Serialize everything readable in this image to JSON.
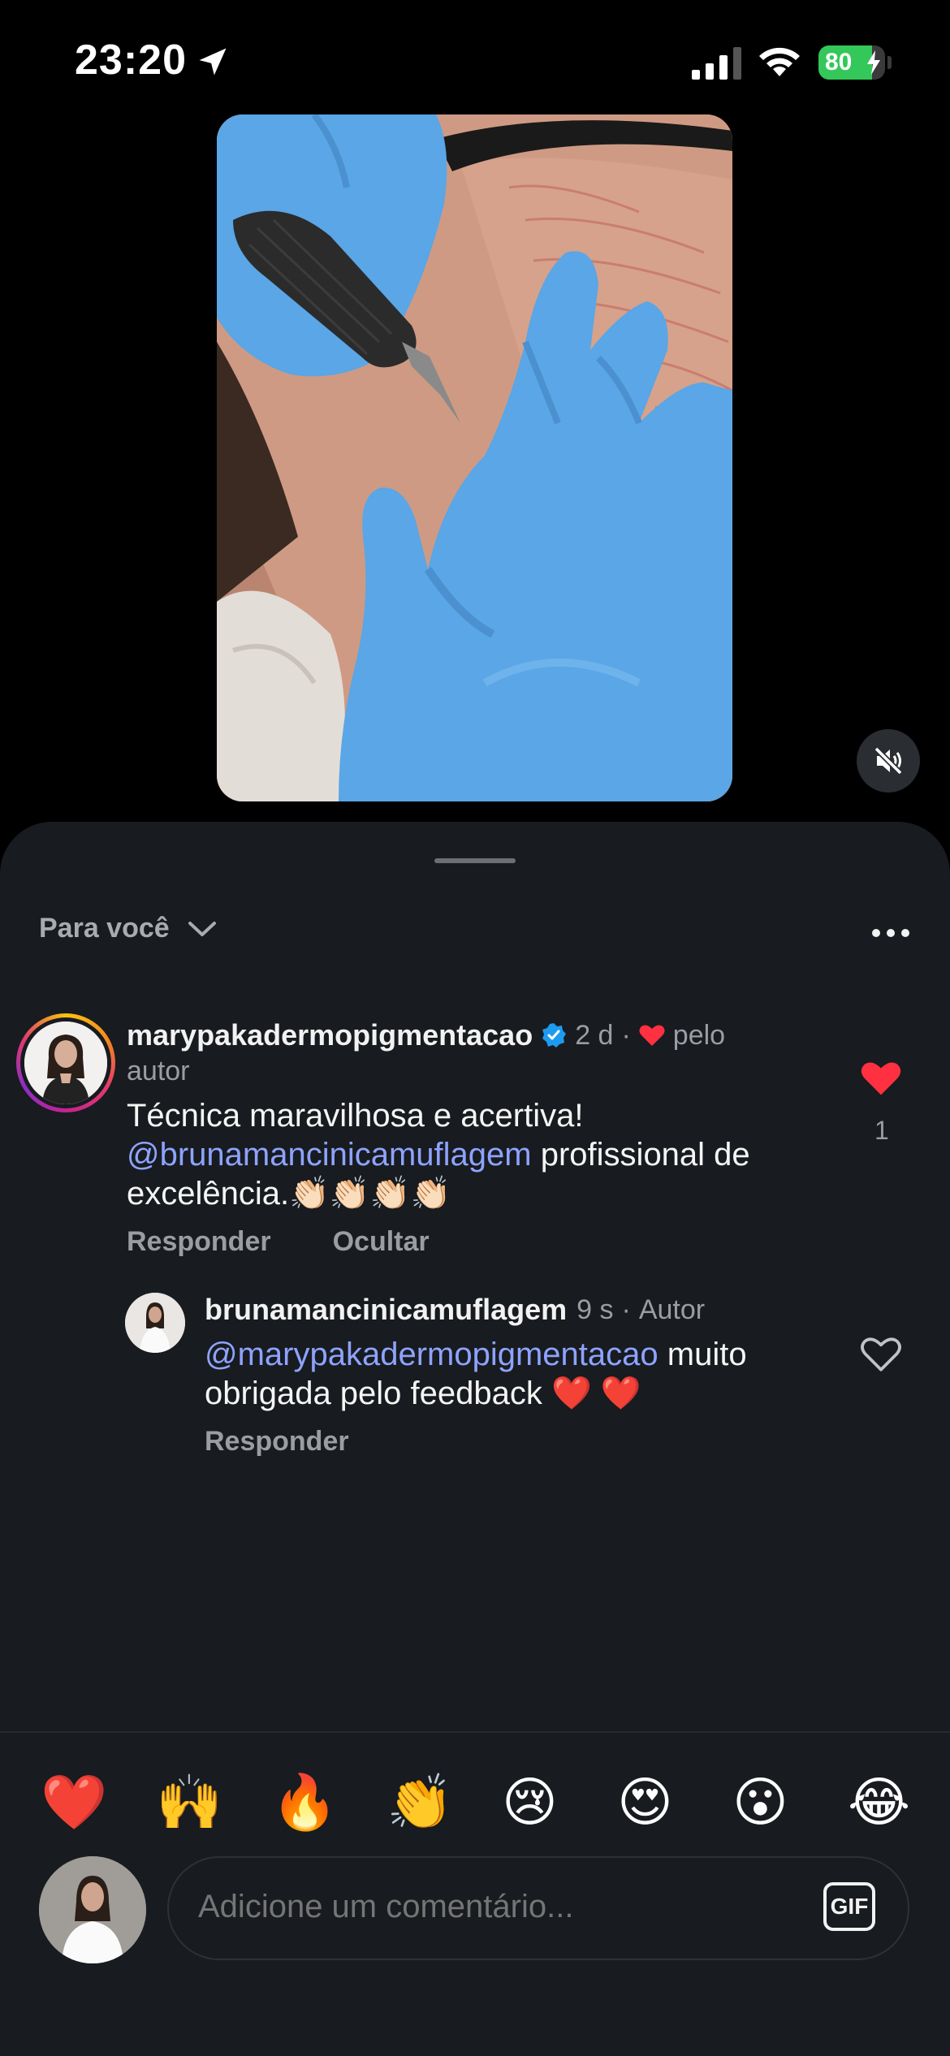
{
  "status_bar": {
    "time": "23:20",
    "battery": "80",
    "battery_level": 0.8
  },
  "video": {
    "muted": true
  },
  "sheet": {
    "filter_label": "Para você"
  },
  "comments": [
    {
      "username": "marypakadermopigmentacao",
      "verified": true,
      "age": "2 d",
      "separator": "·",
      "liked_by_author_label_1": "pelo",
      "liked_by_author_label_2": "autor",
      "text_line1": "Técnica maravilhosa e acertiva!",
      "mention": "@brunamancinicamuflagem",
      "text_line2_rest": " profissional de",
      "text_line3": "excelência.👏🏻👏🏻👏🏻👏🏻",
      "reply_label": "Responder",
      "hide_label": "Ocultar",
      "like_count": "1",
      "liked": true
    },
    {
      "username": "brunamancinicamuflagem",
      "age": "9 s",
      "separator": "·",
      "author_label": "Autor",
      "mention": "@marypakadermopigmentacao",
      "text_line1_rest": " muito",
      "text_line2": "obrigada pelo feedback ❤️ ❤️",
      "reply_label": "Responder",
      "liked": false
    }
  ],
  "reactions": [
    "❤️",
    "🙌",
    "🔥",
    "👏",
    "😢",
    "😍",
    "😮",
    "😂"
  ],
  "composer": {
    "placeholder": "Adicione um comentário...",
    "gif_label": "GIF"
  },
  "colors": {
    "sheet_bg": "#181b1f",
    "mention": "#8ea3ff",
    "like_red": "#ff3040",
    "verified_blue": "#1d9bf0"
  }
}
